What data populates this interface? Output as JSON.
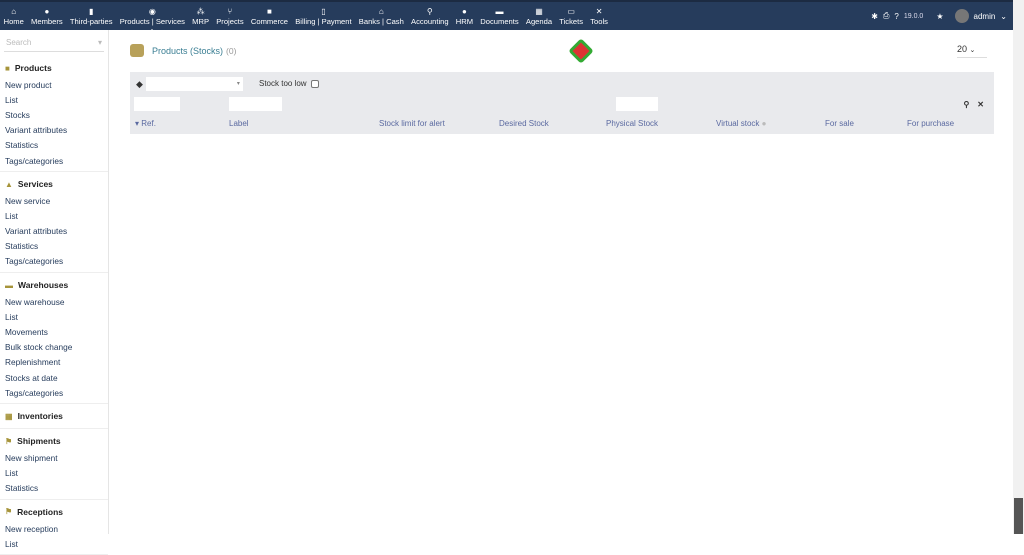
{
  "topnav": {
    "items": [
      {
        "label": "Home",
        "icon": "home-icon",
        "glyph": "⌂"
      },
      {
        "label": "Members",
        "icon": "user-icon",
        "glyph": "●"
      },
      {
        "label": "Third-parties",
        "icon": "building-icon",
        "glyph": "▮"
      },
      {
        "label": "Products | Services",
        "icon": "cube-icon",
        "glyph": "◉"
      },
      {
        "label": "MRP",
        "icon": "cubes-icon",
        "glyph": "⁂"
      },
      {
        "label": "Projects",
        "icon": "sitemap-icon",
        "glyph": "⑂"
      },
      {
        "label": "Commerce",
        "icon": "suitcase-icon",
        "glyph": "■"
      },
      {
        "label": "Billing | Payment",
        "icon": "invoice-icon",
        "glyph": "▯"
      },
      {
        "label": "Banks | Cash",
        "icon": "bank-icon",
        "glyph": "⌂"
      },
      {
        "label": "Accounting",
        "icon": "search-dollar-icon",
        "glyph": "⚲"
      },
      {
        "label": "HRM",
        "icon": "user-tie-icon",
        "glyph": "●"
      },
      {
        "label": "Documents",
        "icon": "folder-icon",
        "glyph": "▬"
      },
      {
        "label": "Agenda",
        "icon": "calendar-icon",
        "glyph": "▦"
      },
      {
        "label": "Tickets",
        "icon": "ticket-icon",
        "glyph": "▭"
      },
      {
        "label": "Tools",
        "icon": "tools-icon",
        "glyph": "✕"
      }
    ],
    "version": "19.0.0",
    "user": "admin"
  },
  "sidebar": {
    "search_placeholder": "Search",
    "groups": [
      {
        "title": "Products",
        "items": [
          "New product",
          "List",
          "Stocks",
          "Variant attributes",
          "Statistics",
          "Tags/categories"
        ]
      },
      {
        "title": "Services",
        "items": [
          "New service",
          "List",
          "Variant attributes",
          "Statistics",
          "Tags/categories"
        ]
      },
      {
        "title": "Warehouses",
        "items": [
          "New warehouse",
          "List",
          "Movements",
          "Bulk stock change",
          "Replenishment",
          "Stocks at date",
          "Tags/categories"
        ]
      },
      {
        "title": "Inventories",
        "items": []
      },
      {
        "title": "Shipments",
        "items": [
          "New shipment",
          "List",
          "Statistics"
        ]
      },
      {
        "title": "Receptions",
        "items": [
          "New reception",
          "List"
        ]
      }
    ]
  },
  "main": {
    "title": "Products (Stocks)",
    "count": "(0)",
    "limit": "20",
    "stock_too_low": "Stock too low",
    "columns": [
      "Ref.",
      "Label",
      "Stock limit for alert",
      "Desired Stock",
      "Physical Stock",
      "Virtual stock",
      "For sale",
      "For purchase"
    ]
  }
}
